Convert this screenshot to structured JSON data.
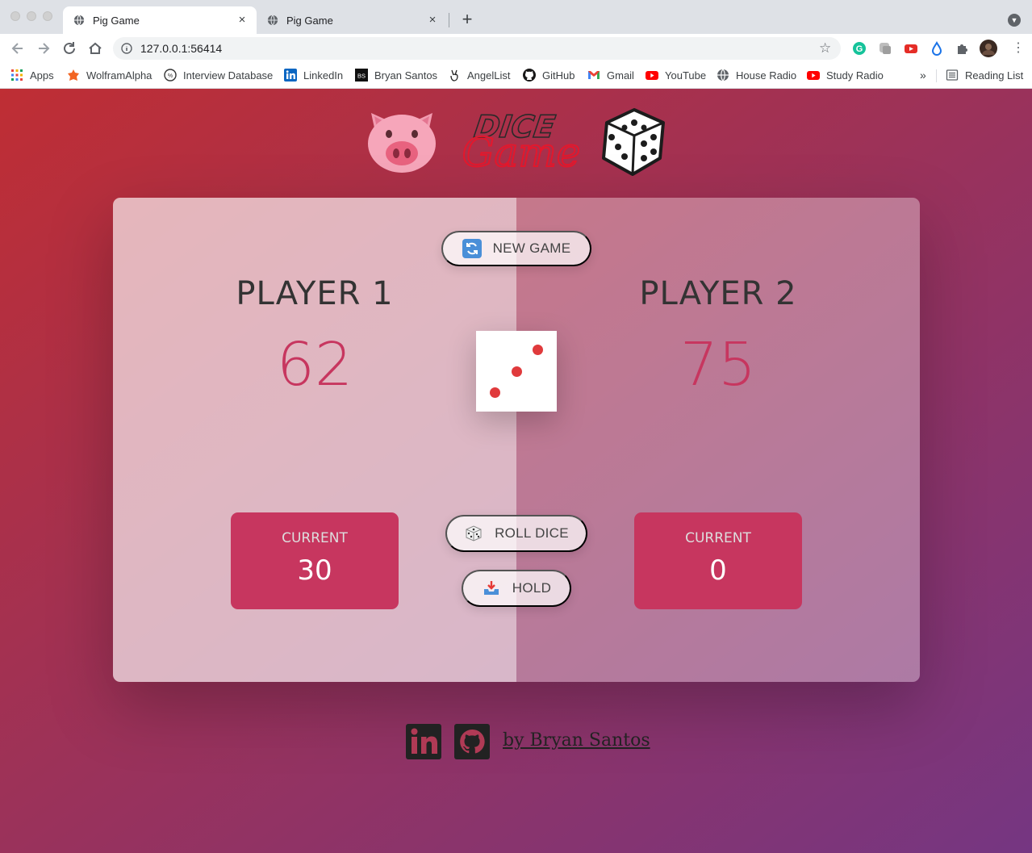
{
  "browser": {
    "tabs": [
      {
        "title": "Pig Game",
        "active": true
      },
      {
        "title": "Pig Game",
        "active": false
      }
    ],
    "new_tab": "+",
    "close_glyph": "×",
    "url": "127.0.0.1:56414",
    "bookmarks": [
      {
        "label": "Apps",
        "icon": "apps-grid-icon"
      },
      {
        "label": "WolframAlpha",
        "icon": "wolframalpha-icon"
      },
      {
        "label": "Interview Database",
        "icon": "interview-database-icon"
      },
      {
        "label": "LinkedIn",
        "icon": "linkedin-icon"
      },
      {
        "label": "Bryan Santos",
        "icon": "bs-icon"
      },
      {
        "label": "AngelList",
        "icon": "angellist-icon"
      },
      {
        "label": "GitHub",
        "icon": "github-icon"
      },
      {
        "label": "Gmail",
        "icon": "gmail-icon"
      },
      {
        "label": "YouTube",
        "icon": "youtube-icon"
      },
      {
        "label": "House Radio",
        "icon": "globe-icon"
      },
      {
        "label": "Study Radio",
        "icon": "youtube-icon"
      }
    ],
    "bookmarks_overflow": "»",
    "reading_list": "Reading List",
    "bs_icon_text": "BS"
  },
  "game": {
    "logo_text_1": "DICE",
    "logo_text_2": "Game",
    "new_game_label": "NEW GAME",
    "roll_label": "ROLL DICE",
    "hold_label": "HOLD",
    "players": [
      {
        "name": "PLAYER 1",
        "score": "62",
        "current_label": "CURRENT",
        "current_score": "30"
      },
      {
        "name": "PLAYER 2",
        "score": "75",
        "current_label": "CURRENT",
        "current_score": "0"
      }
    ],
    "dice_value": 3,
    "score_color": "#c7365f",
    "current_bg": "#c7365f",
    "gradient": [
      "#bf2e34",
      "#753682"
    ]
  },
  "footer": {
    "author": "by Bryan Santos",
    "icons": [
      "linkedin-icon",
      "github-icon"
    ]
  }
}
